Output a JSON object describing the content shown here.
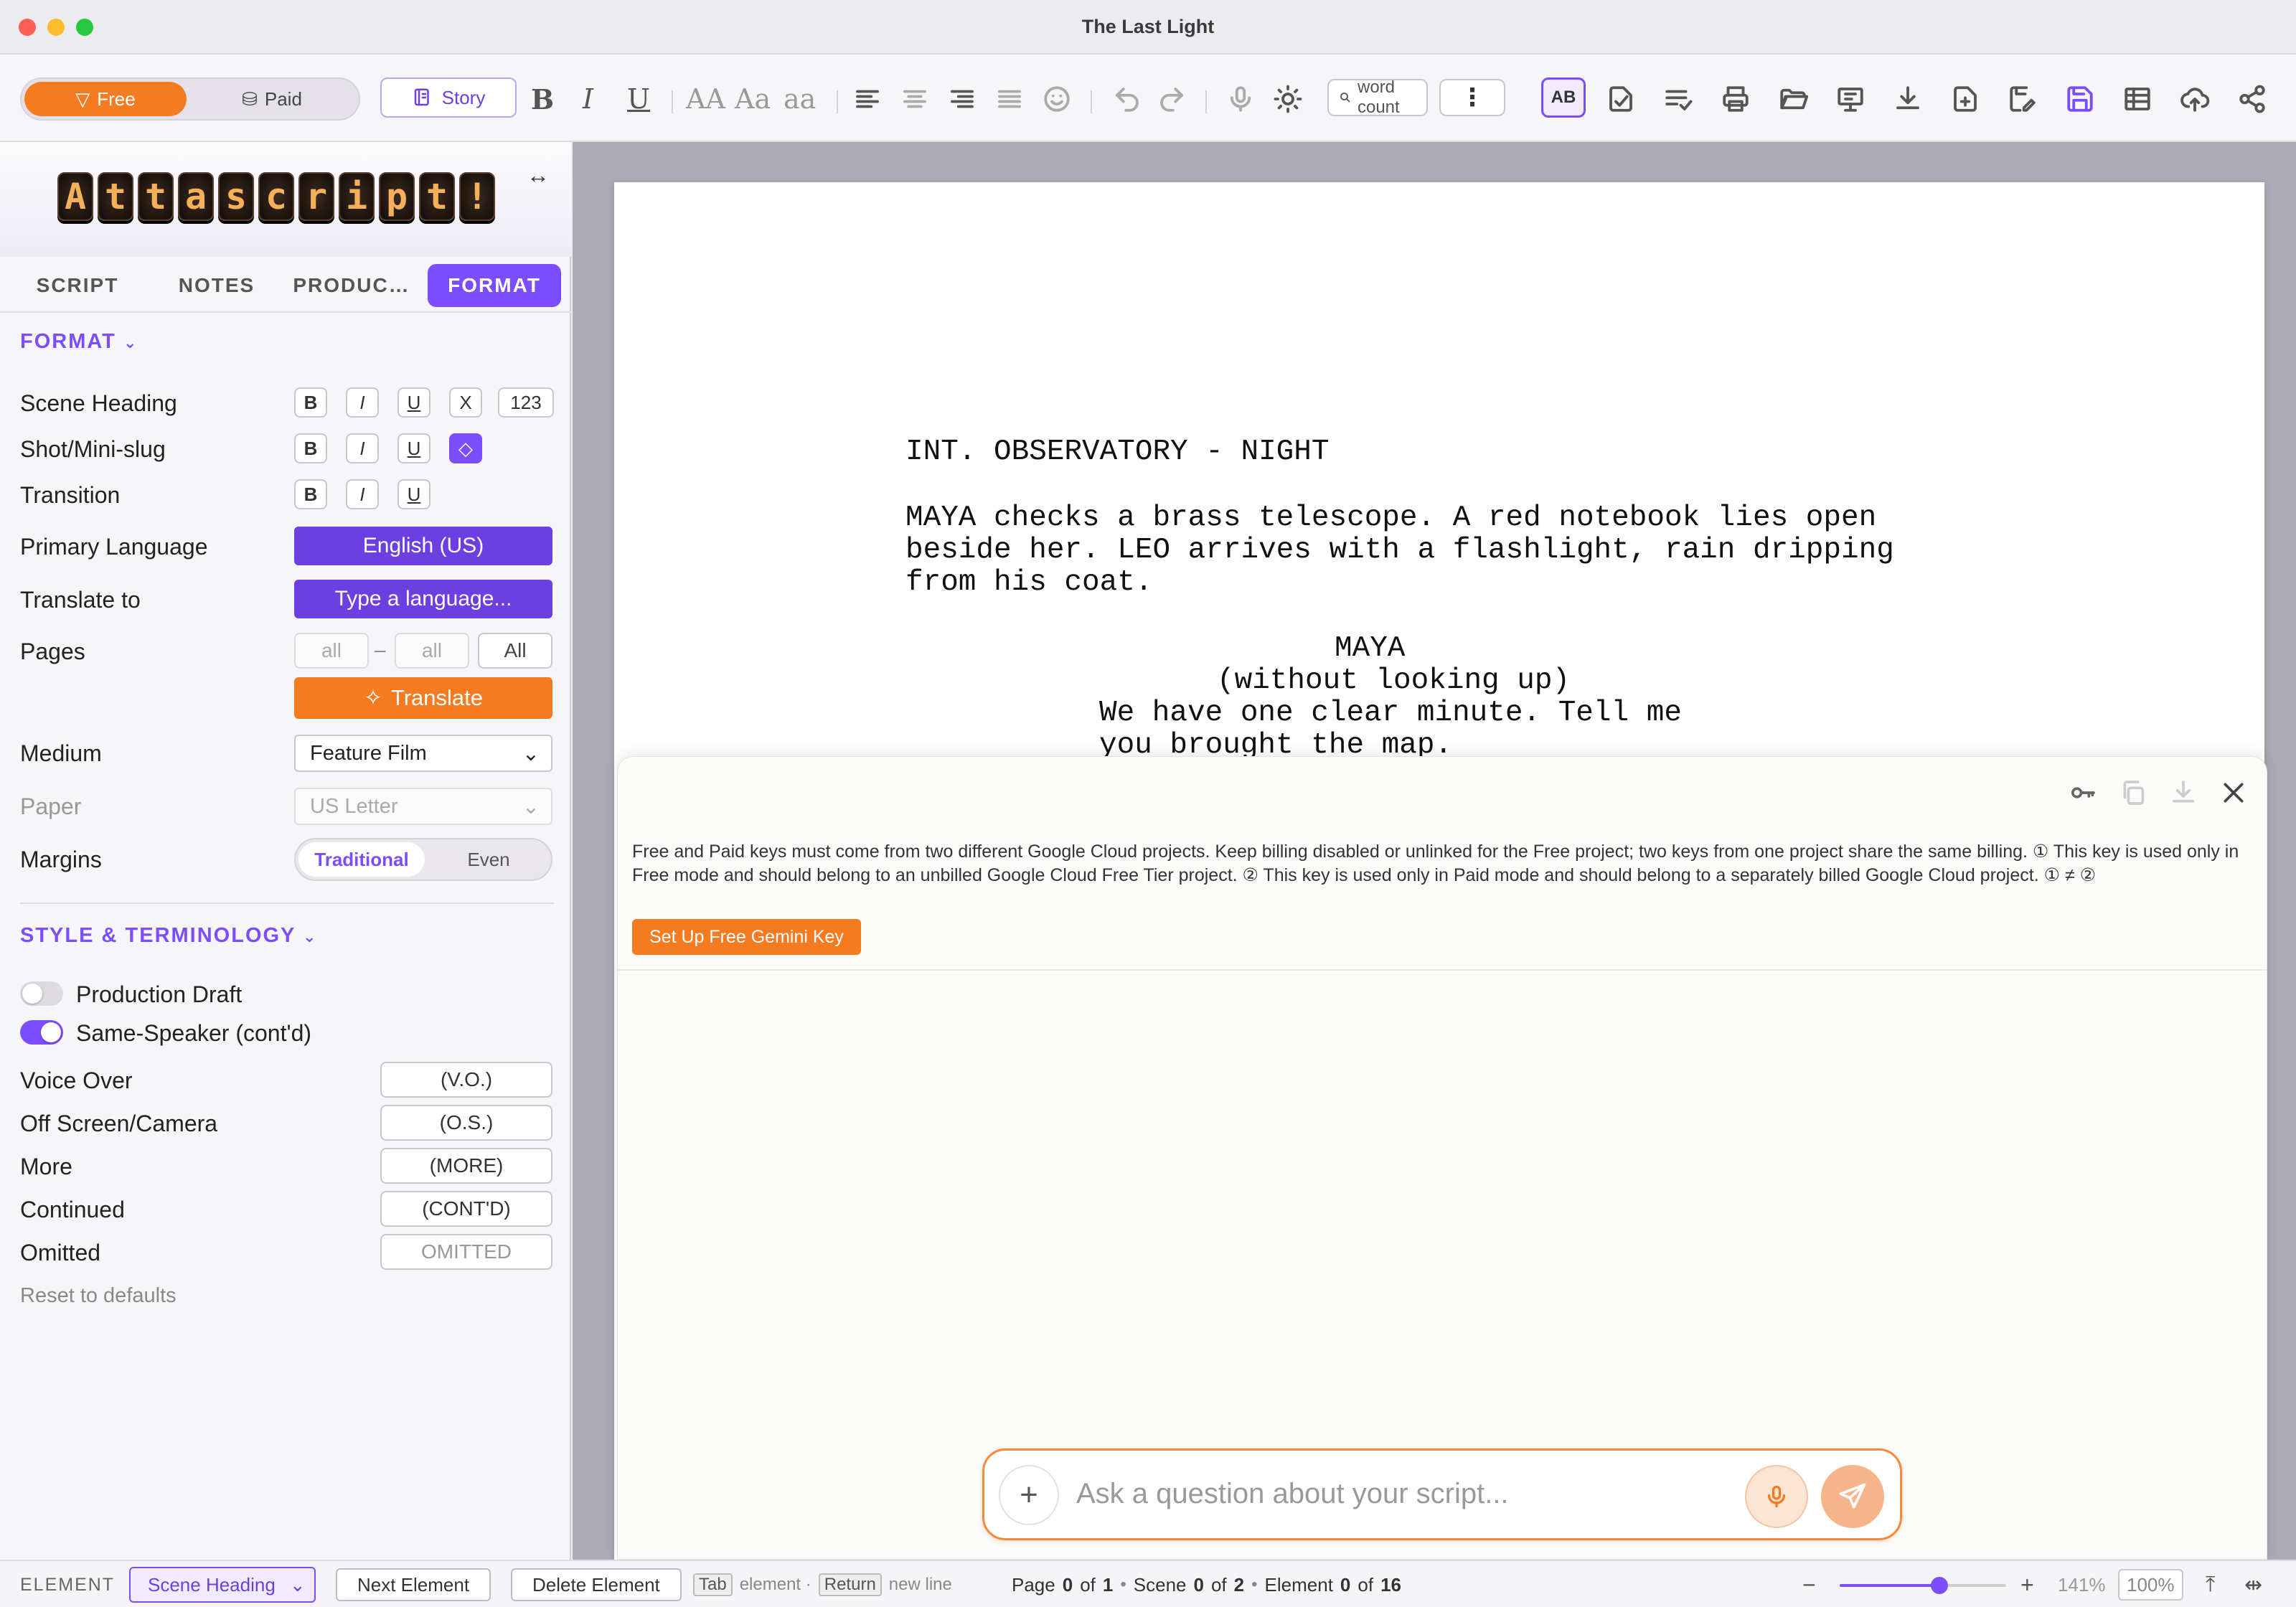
{
  "window": {
    "title": "The Last Light"
  },
  "toolbar": {
    "mode_free": "Free",
    "mode_paid": "Paid",
    "story_label": "Story",
    "bold": "B",
    "italic": "I",
    "underline": "U",
    "case_upper": "AA",
    "case_title": "Aa",
    "case_lower": "aa",
    "search_placeholder": "word count",
    "more_label": "⋮",
    "spellcheck_label": "AB"
  },
  "sidebar": {
    "logo_text": "Attascript!",
    "tabs": [
      "SCRIPT",
      "NOTES",
      "PRODUC…",
      "FORMAT"
    ],
    "format_section": "FORMAT",
    "rows": {
      "scene_heading": "Scene Heading",
      "shot": "Shot/Mini-slug",
      "transition": "Transition",
      "primary_language": "Primary Language",
      "translate_to": "Translate to",
      "pages": "Pages",
      "medium": "Medium",
      "paper": "Paper",
      "margins": "Margins"
    },
    "format_buttons": {
      "b": "B",
      "i": "I",
      "u": "U",
      "x": "X",
      "num": "123"
    },
    "primary_language_value": "English (US)",
    "translate_placeholder": "Type a language...",
    "pages_from": "all",
    "pages_dash": "–",
    "pages_to": "all",
    "pages_all": "All",
    "translate_button": "Translate",
    "medium_value": "Feature Film",
    "paper_value": "US Letter",
    "margins_options": [
      "Traditional",
      "Even"
    ],
    "style_section": "STYLE & TERMINOLOGY",
    "toggles": [
      {
        "label": "Production Draft",
        "on": false
      },
      {
        "label": "Same-Speaker (cont'd)",
        "on": true
      }
    ],
    "terms": [
      {
        "label": "Voice Over",
        "value": "(V.O.)"
      },
      {
        "label": "Off Screen/Camera",
        "value": "(O.S.)"
      },
      {
        "label": "More",
        "value": "(MORE)"
      },
      {
        "label": "Continued",
        "value": "(CONT'D)"
      },
      {
        "label": "Omitted",
        "value": "OMITTED"
      }
    ],
    "reset": "Reset to defaults"
  },
  "script": {
    "scene_heading": "INT. OBSERVATORY - NIGHT",
    "action": [
      "MAYA checks a brass telescope. A red notebook lies open",
      "beside her. LEO arrives with a flashlight, rain dripping",
      "from his coat."
    ],
    "character": "MAYA",
    "parenthetical": "(without looking up)",
    "dialogue": [
      "We have one clear minute. Tell me",
      "you brought the map."
    ]
  },
  "ai_panel": {
    "note": "Free and Paid keys must come from two different Google Cloud projects. Keep billing disabled or unlinked for the Free project; two keys from one project share the same billing. ① This key is used only in Free mode and should belong to an unbilled Google Cloud Free Tier project. ② This key is used only in Paid mode and should belong to a separately billed Google Cloud project. ① ≠ ②",
    "setup_button": "Set Up Free Gemini Key",
    "chat_placeholder": "Ask a question about your script..."
  },
  "statusbar": {
    "element_label": "ELEMENT",
    "element_value": "Scene Heading",
    "next_button": "Next Element",
    "delete_button": "Delete Element",
    "tab_key": "Tab",
    "tab_hint": "element ·",
    "return_key": "Return",
    "return_hint": "new line",
    "page_prefix": "Page",
    "page_cur": "0",
    "page_of": "of",
    "page_total": "1",
    "scene_prefix": "Scene",
    "scene_cur": "0",
    "scene_of": "of",
    "scene_total": "2",
    "element_prefix": "Element",
    "element_cur": "0",
    "element_of": "of",
    "element_total": "16",
    "zoom_value": "141%",
    "zoom_reset": "100%",
    "zoom_level": 0.6
  },
  "colors": {
    "accent": "#7c4dff",
    "orange": "#f47b20"
  }
}
